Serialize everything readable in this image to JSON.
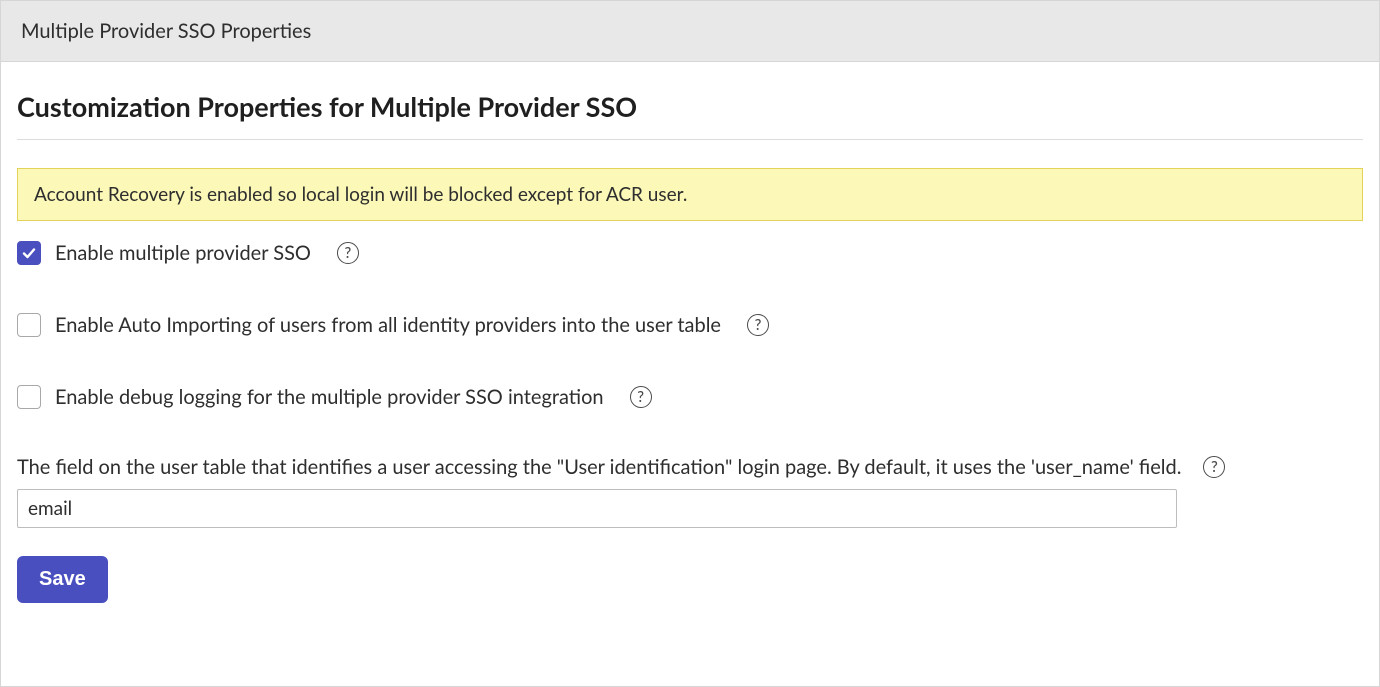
{
  "header": {
    "title": "Multiple Provider SSO Properties"
  },
  "page_title": "Customization Properties for Multiple Provider SSO",
  "alert": {
    "message": "Account Recovery is enabled so local login will be blocked except for ACR user."
  },
  "fields": {
    "enable_sso": {
      "label": "Enable multiple provider SSO",
      "checked": true
    },
    "enable_auto_import": {
      "label": "Enable Auto Importing of users from all identity providers into the user table",
      "checked": false
    },
    "enable_debug": {
      "label": "Enable debug logging for the multiple provider SSO integration",
      "checked": false
    },
    "user_field": {
      "description": "The field on the user table that identifies a user accessing the \"User identification\" login page. By default, it uses the 'user_name' field.",
      "value": "email"
    }
  },
  "help_glyph": "?",
  "buttons": {
    "save": "Save"
  }
}
